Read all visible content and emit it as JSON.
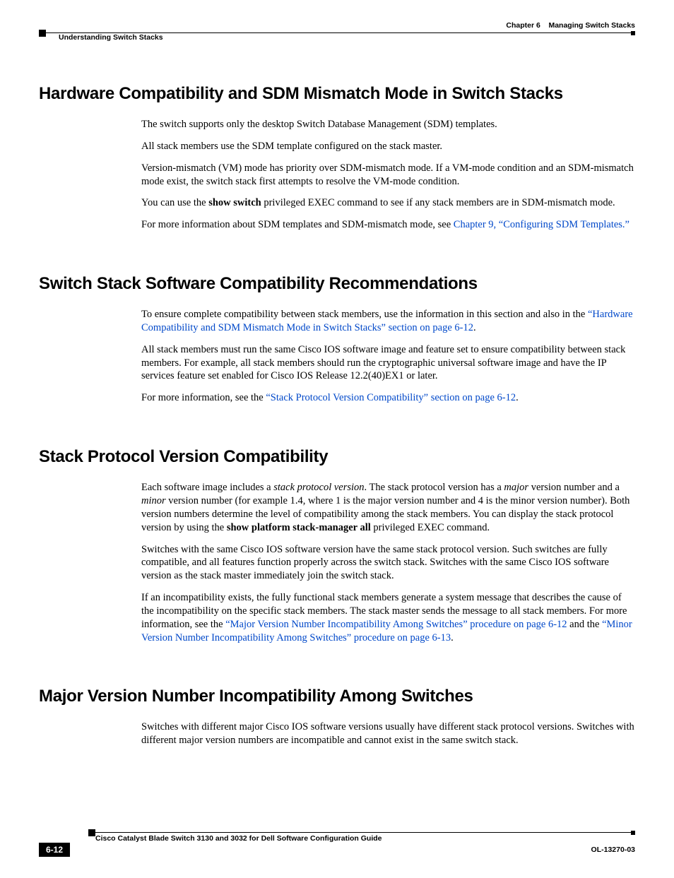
{
  "header": {
    "left": "Understanding Switch Stacks",
    "chapter_label": "Chapter 6",
    "chapter_title": "Managing Switch Stacks"
  },
  "s1": {
    "heading": "Hardware Compatibility and SDM Mismatch Mode in Switch Stacks",
    "p1": "The switch supports only the desktop Switch Database Management (SDM) templates.",
    "p2": "All stack members use the SDM template configured on the stack master.",
    "p3": "Version-mismatch (VM) mode has priority over SDM-mismatch mode. If a VM-mode condition and an SDM-mismatch mode exist, the switch stack first attempts to resolve the VM-mode condition.",
    "p4_a": "You can use the ",
    "p4_b": "show switch",
    "p4_c": " privileged EXEC command to see if any stack members are in SDM-mismatch mode.",
    "p5_a": "For more information about SDM templates and SDM-mismatch mode, see ",
    "p5_link": "Chapter 9, “Configuring SDM Templates.”"
  },
  "s2": {
    "heading": "Switch Stack Software Compatibility Recommendations",
    "p1_a": "To ensure complete compatibility between stack members, use the information in this section and also in the ",
    "p1_link": "“Hardware Compatibility and SDM Mismatch Mode in Switch Stacks” section on page 6-12",
    "p1_b": ".",
    "p2": "All stack members must run the same Cisco IOS software image and feature set to ensure compatibility between stack members. For example, all stack members should run the cryptographic universal software image and have the IP services feature set enabled for Cisco IOS Release 12.2(40)EX1 or later.",
    "p3_a": "For more information, see the ",
    "p3_link": "“Stack Protocol Version Compatibility” section on page 6-12",
    "p3_b": "."
  },
  "s3": {
    "heading": "Stack Protocol Version Compatibility",
    "p1_a": "Each software image includes a ",
    "p1_i1": "stack protocol version",
    "p1_b": ". The stack protocol version has a ",
    "p1_i2": "major",
    "p1_c": " version number and a ",
    "p1_i3": "minor",
    "p1_d": " version number (for example 1.4, where 1 is the major version number and 4 is the minor version number). Both version numbers determine the level of compatibility among the stack members. You can display the stack protocol version by using the ",
    "p1_bold": "show platform stack-manager all",
    "p1_e": " privileged EXEC command.",
    "p2": "Switches with the same Cisco IOS software version have the same stack protocol version. Such switches are fully compatible, and all features function properly across the switch stack. Switches with the same Cisco IOS software version as the stack master immediately join the switch stack.",
    "p3_a": "If an incompatibility exists, the fully functional stack members generate a system message that describes the cause of the incompatibility on the specific stack members. The stack master sends the message to all stack members. For more information, see the ",
    "p3_link1": "“Major Version Number Incompatibility Among Switches” procedure on page 6-12",
    "p3_b": " and the ",
    "p3_link2": "“Minor Version Number Incompatibility Among Switches” procedure on page 6-13",
    "p3_c": "."
  },
  "s4": {
    "heading": "Major Version Number Incompatibility Among Switches",
    "p1": "Switches with different major Cisco IOS software versions usually have different stack protocol versions. Switches with different major version numbers are incompatible and cannot exist in the same switch stack."
  },
  "footer": {
    "guide_title": "Cisco Catalyst Blade Switch 3130 and 3032 for Dell Software Configuration Guide",
    "page_num": "6-12",
    "doc_id": "OL-13270-03"
  }
}
